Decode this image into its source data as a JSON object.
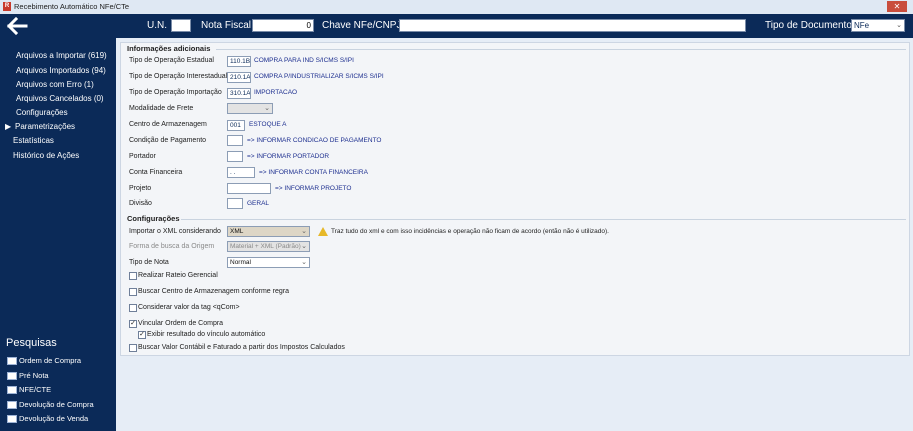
{
  "window": {
    "title": "Recebimento Automático NFe/CTe",
    "icon_glyph": "R"
  },
  "header": {
    "un_label": "U.N.",
    "un_value": "",
    "nota_label": "Nota Fiscal",
    "nota_value": "0",
    "chave_label": "Chave NFe/CNPJ",
    "chave_value": "",
    "tipo_label": "Tipo de Documento",
    "tipo_value": "NFe"
  },
  "sidebar": {
    "items": [
      {
        "label": "Arquivos a Importar (619)"
      },
      {
        "label": "Arquivos Importados (94)"
      },
      {
        "label": "Arquivos com Erro (1)"
      },
      {
        "label": "Arquivos Cancelados (0)"
      },
      {
        "label": "Configurações"
      },
      {
        "label": "Parametrizações",
        "active": true
      },
      {
        "label": "Estatísticas"
      },
      {
        "label": "Histórico de Ações"
      }
    ],
    "pesquisas_title": "Pesquisas",
    "pesquisas": [
      {
        "label": "Ordem de Compra"
      },
      {
        "label": "Pré Nota"
      },
      {
        "label": "NFE/CTE"
      },
      {
        "label": "Devolução de Compra"
      },
      {
        "label": "Devolução de Venda"
      }
    ]
  },
  "info": {
    "title": "Informações adicionais",
    "rows": [
      {
        "label": "Tipo de Operação Estadual",
        "value": "110.1B",
        "desc": "COMPRA PARA IND S/ICMS S/IPI"
      },
      {
        "label": "Tipo de Operação Interestadual",
        "value": "210.1A",
        "desc": "COMPRA P/INDUSTRIALIZAR S/ICMS S/IPI"
      },
      {
        "label": "Tipo de Operação Importação",
        "value": "310.1A",
        "desc": "IMPORTACAO"
      },
      {
        "label": "Modalidade de Frete",
        "value": ""
      },
      {
        "label": "Centro de Armazenagem",
        "value": "001",
        "desc": "ESTOQUE A"
      },
      {
        "label": "Condição de Pagamento",
        "value": "",
        "desc": "=> INFORMAR CONDICAO DE PAGAMENTO"
      },
      {
        "label": "Portador",
        "value": "",
        "desc": "=> INFORMAR PORTADOR"
      },
      {
        "label": "Conta Financeira",
        "value": ". .",
        "desc": "=> INFORMAR CONTA FINANCEIRA"
      },
      {
        "label": "Projeto",
        "value": "",
        "desc": "=> INFORMAR PROJETO"
      },
      {
        "label": "Divisão",
        "value": "",
        "desc": "GERAL"
      }
    ]
  },
  "config": {
    "title": "Configurações",
    "importar_label": "Importar o XML considerando",
    "importar_value": "XML",
    "importar_warning": "Traz tudo do xml e com isso incidências e operação não ficam de acordo (então não é utilizado).",
    "forma_label": "Forma de busca da Origem",
    "forma_value": "Material + XML (Padrão)",
    "tipo_nota_label": "Tipo de Nota",
    "tipo_nota_value": "Normal",
    "checkboxes": [
      {
        "label": "Realizar Rateio Gerencial",
        "checked": false
      },
      {
        "label": "Buscar Centro de Armazenagem conforme regra",
        "checked": false
      },
      {
        "label": "Considerar valor da tag <qCom>",
        "checked": false
      },
      {
        "label": "Vincular Ordem de Compra",
        "checked": true
      },
      {
        "label": "Exibir resultado do vínculo automático",
        "checked": true
      },
      {
        "label": "Buscar Valor Contábil e Faturado a partir dos Impostos Calculados",
        "checked": false
      }
    ]
  },
  "colors": {
    "navy": "#0b2a58",
    "panel": "#f3f5f8",
    "link_text": "#1d2f8f",
    "close": "#c94d3c"
  },
  "icons": {
    "back": "arrow-left-icon",
    "warning": "warning-icon",
    "pesquisa": "window-icon",
    "check": "checkmark-icon"
  }
}
